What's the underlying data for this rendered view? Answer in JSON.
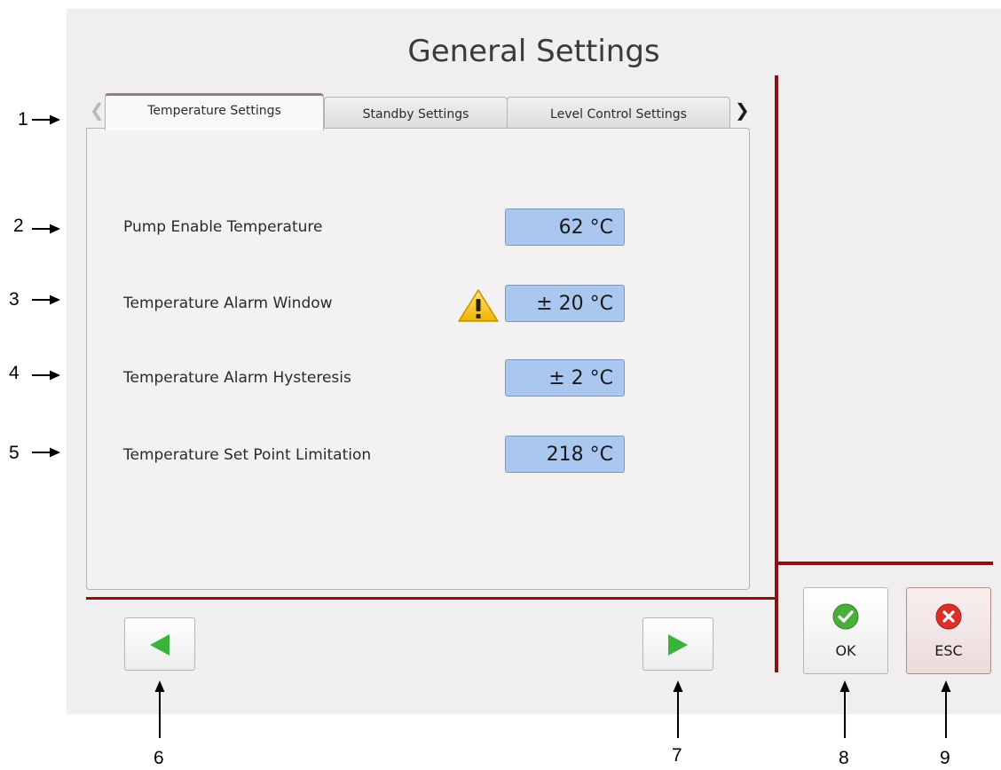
{
  "window": {
    "title": "General Settings"
  },
  "tabs": [
    {
      "label": "Temperature Settings",
      "active": true
    },
    {
      "label": "Standby Settings",
      "active": false
    },
    {
      "label": "Level Control Settings",
      "active": false
    }
  ],
  "tab_scroll": {
    "left_icon": "chevron-left-icon",
    "right_icon": "chevron-right-icon"
  },
  "settings": [
    {
      "label": "Pump Enable Temperature",
      "value": "62 °C",
      "warning": false
    },
    {
      "label": "Temperature Alarm Window",
      "value": "± 20 °C",
      "warning": true
    },
    {
      "label": "Temperature Alarm Hysteresis",
      "value": "± 2 °C",
      "warning": false
    },
    {
      "label": "Temperature Set Point Limitation",
      "value": "218 °C",
      "warning": false
    }
  ],
  "buttons": {
    "prev_icon": "arrow-left-icon",
    "next_icon": "arrow-right-icon",
    "ok_label": "OK",
    "esc_label": "ESC"
  },
  "colors": {
    "divider": "#8b1010",
    "value_field": "#a9c7ef",
    "ok_green": "#4cae3a",
    "esc_red": "#d9302b",
    "nav_arrow": "#3bb33b"
  },
  "callouts": [
    "1",
    "2",
    "3",
    "4",
    "5",
    "6",
    "7",
    "8",
    "9"
  ]
}
